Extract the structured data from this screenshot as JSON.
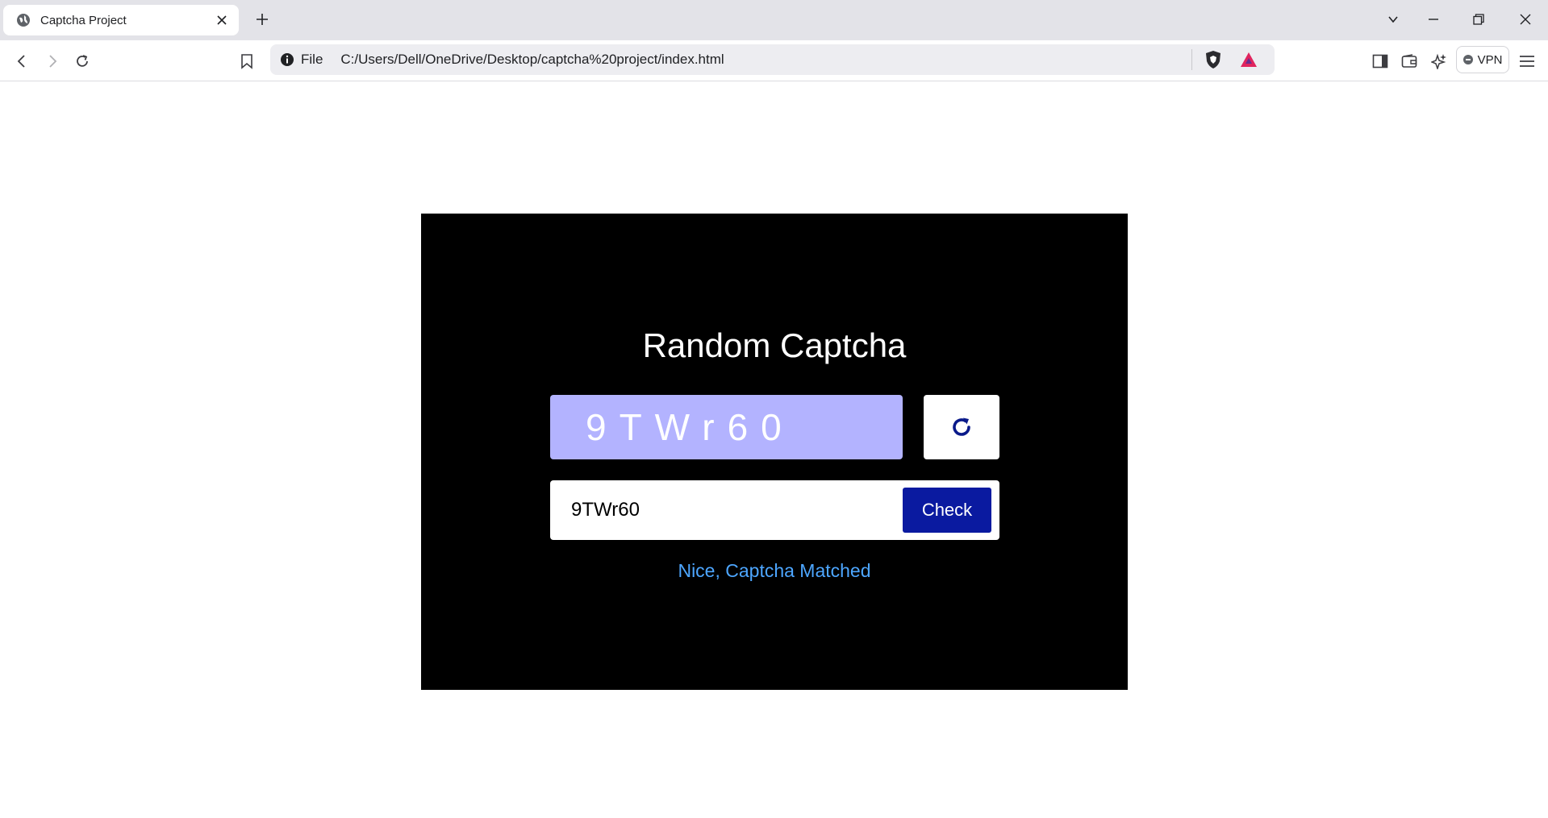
{
  "browser": {
    "tab": {
      "title": "Captcha Project"
    },
    "address_bar": {
      "scheme_label": "File",
      "url": "C:/Users/Dell/OneDrive/Desktop/captcha%20project/index.html"
    },
    "vpn_label": "VPN"
  },
  "page": {
    "title": "Random Captcha",
    "captcha_code": "9TWr60",
    "input": {
      "value": "9TWr60",
      "placeholder": ""
    },
    "check_label": "Check",
    "status_message": "Nice, Captcha Matched"
  },
  "colors": {
    "card_background": "#000000",
    "captcha_box": "#b3b3ff",
    "check_button": "#0a1aa0",
    "refresh_icon": "#0a1a8a",
    "success_text": "#4da6ff"
  },
  "icons": [
    "globe-icon",
    "close-icon",
    "plus-icon",
    "chevron-down-icon",
    "minimize-icon",
    "restore-icon",
    "back-icon",
    "forward-icon",
    "reload-icon",
    "bookmark-icon",
    "info-icon",
    "brave-shield-icon",
    "bat-rewards-icon",
    "sidebar-icon",
    "wallet-icon",
    "leo-ai-icon",
    "menu-icon",
    "refresh-icon"
  ]
}
